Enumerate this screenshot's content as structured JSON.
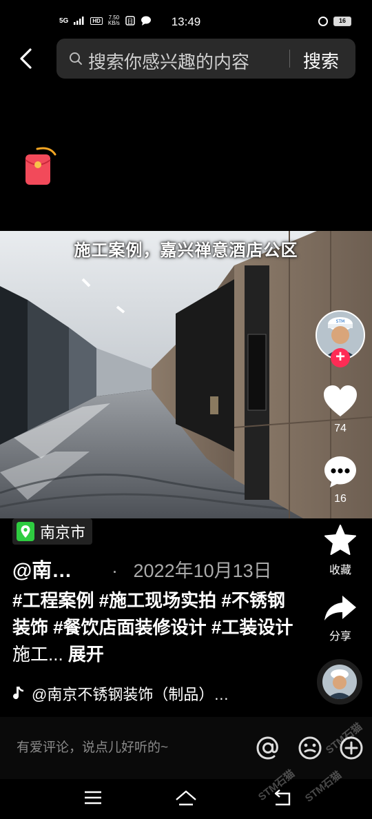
{
  "status_bar": {
    "network": "5G",
    "hd": "HD",
    "speed": "7.50",
    "speed_unit": "KB/s",
    "time": "13:49",
    "battery": "16"
  },
  "search": {
    "placeholder": "搜索你感兴趣的内容",
    "button_label": "搜索"
  },
  "video": {
    "caption": "施工案例，嘉兴禅意酒店公区"
  },
  "actions": {
    "likes": "74",
    "comments": "16",
    "favorite_label": "收藏",
    "share_label": "分享"
  },
  "post": {
    "location": "南京市",
    "author": "@南…",
    "date_separator": "·",
    "date": "2022年10月13日",
    "description_tags": "#工程案例 #施工现场实拍 #不锈钢装饰 #餐饮店面装修设计 #工装设计",
    "description_tail": " 施工...",
    "expand_label": " 展开",
    "music": "@南京不锈钢装饰（制品）…"
  },
  "comment_bar": {
    "placeholder": "有爱评论，说点儿好听的~"
  },
  "watermark": {
    "text": "STM石猫"
  },
  "colors": {
    "accent_red": "#fe2c55",
    "location_green": "#2ecc40"
  }
}
